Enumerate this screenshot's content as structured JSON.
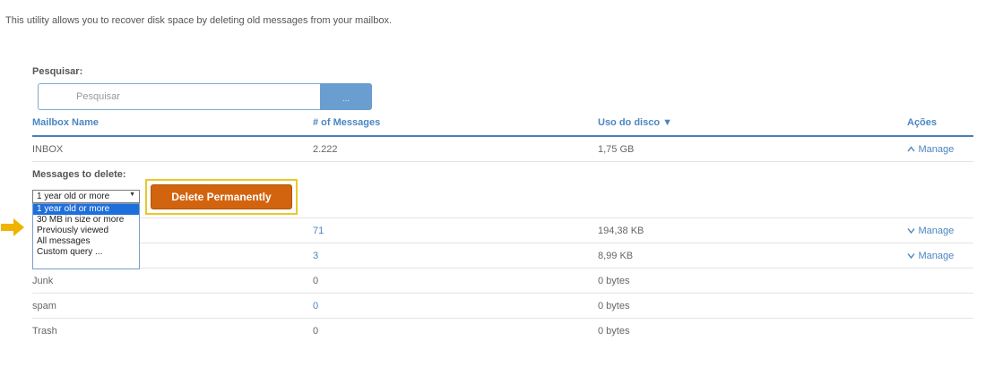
{
  "intro_text": "This utility allows you to recover disk space by deleting old messages from your mailbox.",
  "search": {
    "label": "Pesquisar:",
    "placeholder": "Pesquisar",
    "value": "",
    "button_label": "..."
  },
  "table": {
    "headers": {
      "name": "Mailbox Name",
      "messages": "# of Messages",
      "disk": "Uso do disco ▼",
      "actions": "Ações"
    },
    "rows": [
      {
        "name": "INBOX",
        "messages": "2.222",
        "disk": "1,75 GB",
        "action": "Manage",
        "expanded": true
      },
      {
        "name": "",
        "messages": "71",
        "disk": "194,38 KB",
        "action": "Manage",
        "expanded": false
      },
      {
        "name": "",
        "messages": "3",
        "disk": "8,99 KB",
        "action": "Manage",
        "expanded": false
      },
      {
        "name": "Junk",
        "messages": "0",
        "disk": "0 bytes",
        "action": ""
      },
      {
        "name": "spam",
        "messages": "0",
        "disk": "0 bytes",
        "action": ""
      },
      {
        "name": "Trash",
        "messages": "0",
        "disk": "0 bytes",
        "action": ""
      }
    ]
  },
  "delete_panel": {
    "label": "Messages to delete:",
    "selected": "1 year old or more",
    "options": [
      "1 year old or more",
      "30 MB in size or more",
      "Previously viewed",
      "All messages",
      "Custom query ..."
    ],
    "button_label": "Delete Permanently"
  },
  "icons": {
    "expanded": "chevron-up-icon",
    "collapsed": "chevron-down-icon",
    "pointer": "arrow-right-icon"
  },
  "colors": {
    "accent": "#4a86c2",
    "delete_button": "#d3640f",
    "highlight": "#e9c92a",
    "pointer_arrow": "#f0b400"
  }
}
